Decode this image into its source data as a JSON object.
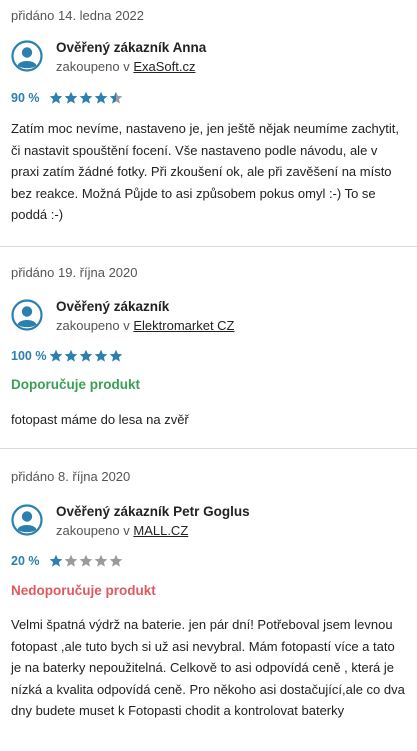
{
  "colors": {
    "accent": "#2b80b0",
    "star_filled": "#2b80b0",
    "star_empty": "#9b9b9b",
    "recommend": "#3aa053",
    "not_recommend": "#e0585f"
  },
  "reviews": [
    {
      "date": "přidáno 14. ledna 2022",
      "author": "Ověřený zákazník Anna",
      "bought_prefix": "zakoupeno v",
      "shop": "ExaSoft.cz",
      "percent": "90 %",
      "rating": 4.5,
      "recommendation": "",
      "text": "Zatím moc nevíme, nastaveno je, jen ještě nějak neumíme zachytit, či nastavit spouštění focení. Vše nastaveno podle návodu, ale v praxi zatím žádné fotky. Při zkoušení ok, ale při zavěšení na místo bez reakce. Možná Půjde to asi způsobem pokus omyl :-) To se poddá :-)"
    },
    {
      "date": "přidáno 19. října 2020",
      "author": "Ověřený zákazník",
      "bought_prefix": "zakoupeno v",
      "shop": "Elektromarket CZ",
      "percent": "100 %",
      "rating": 5,
      "recommendation": "Doporučuje produkt",
      "text": "fotopast máme do lesa na zvěř"
    },
    {
      "date": "přidáno 8. října 2020",
      "author": "Ověřený zákazník Petr Goglus",
      "bought_prefix": "zakoupeno v",
      "shop": "MALL.CZ",
      "percent": "20 %",
      "rating": 1,
      "recommendation": "Nedoporučuje produkt",
      "text": "Velmi špatná výdrž na baterie. jen pár dní! Potřeboval jsem levnou fotopast ,ale tuto bych si už asi nevybral. Mám fotopastí více a tato je na baterky nepoužitelná. Celkově to asi odpovídá ceně , která je nízká a kvalita odpovídá ceně. Pro někoho asi dostačující,ale co dva dny budete muset k Fotopasti chodit a kontrolovat baterky"
    }
  ]
}
